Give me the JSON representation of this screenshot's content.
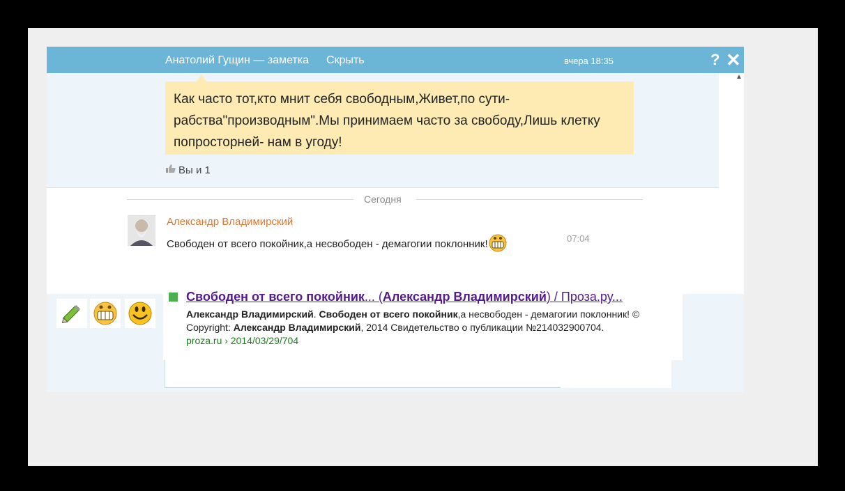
{
  "header": {
    "title": "Анатолий Гущин — заметка",
    "hide_label": "Скрыть",
    "time": "вчера 18:35",
    "help_label": "?",
    "close_label": "✕"
  },
  "note": {
    "line1": "Как часто тот,кто мнит себя свободным,Живет,по сути-",
    "line2": "рабства\"производным\".Мы принимаем часто за свободу,Лишь клетку",
    "line3": "попросторней- нам в угоду!",
    "likes": "Вы и 1"
  },
  "divider": {
    "label": "Сегодня"
  },
  "comment": {
    "author": "Александр Владимирский",
    "text": "Свободен от всего покойник,а несвободен - демагогии поклонник!",
    "time": "07:04"
  },
  "pasted": {
    "title_part1": "Свободен от всего покойник",
    "title_part2": "... (",
    "title_part3": "Александр Владимирский",
    "title_part4": ") / Проза.ру...",
    "desc_bold1": "Александр Владимирский",
    "desc_sep1": ". ",
    "desc_bold2": "Свободен от всего покойник",
    "desc_text1": ",а несвободен - демагогии поклонник! © Copyright: ",
    "desc_bold3": "Александр Владимирский",
    "desc_text2": ", 2014 Свидетельство о публикации №214032900704.",
    "url": "proza.ru › 2014/03/29/704"
  },
  "toolbar": {
    "icons": [
      "pencil-icon",
      "grin-smiley-icon",
      "smile-smiley-icon"
    ]
  },
  "colors": {
    "header_bg": "#6bb6d6",
    "note_bg": "#fdebb3",
    "author": "#e07830",
    "link": "#551a8b",
    "url": "#1a7f1a"
  }
}
